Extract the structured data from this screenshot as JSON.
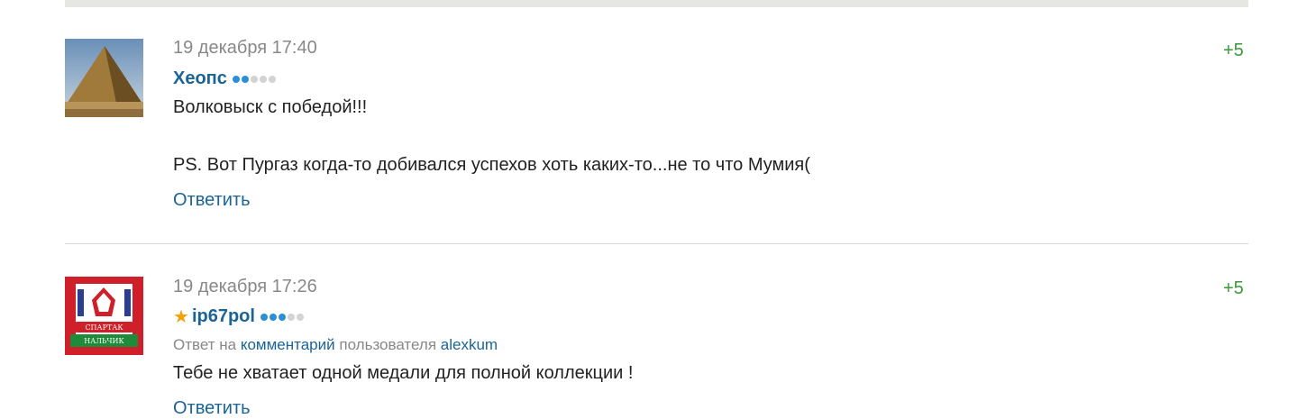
{
  "comments": [
    {
      "date": "19 декабря 17:40",
      "author": "Хеопс",
      "rating_level": 2,
      "rating_max": 5,
      "text_lines": [
        "Волковыск с победой!!!",
        "PS. Вот Пургаз когда-то добивался успехов хоть каких-то...не то что Мумия("
      ],
      "reply_label": "Ответить",
      "score": "+5"
    },
    {
      "date": "19 декабря 17:26",
      "author": "ip67pol",
      "starred": true,
      "rating_level": 3,
      "rating_max": 5,
      "reply_to": {
        "prefix": "Ответ на",
        "link": "комментарий",
        "middle": "пользователя",
        "user": "alexkum"
      },
      "text": "Тебе не хватает одной медали для полной коллекции !",
      "reply_label": "Ответить",
      "score": "+5"
    }
  ],
  "avatar_text": {
    "top": "СПАРТАК",
    "bottom": "НАЛЬЧИК"
  }
}
